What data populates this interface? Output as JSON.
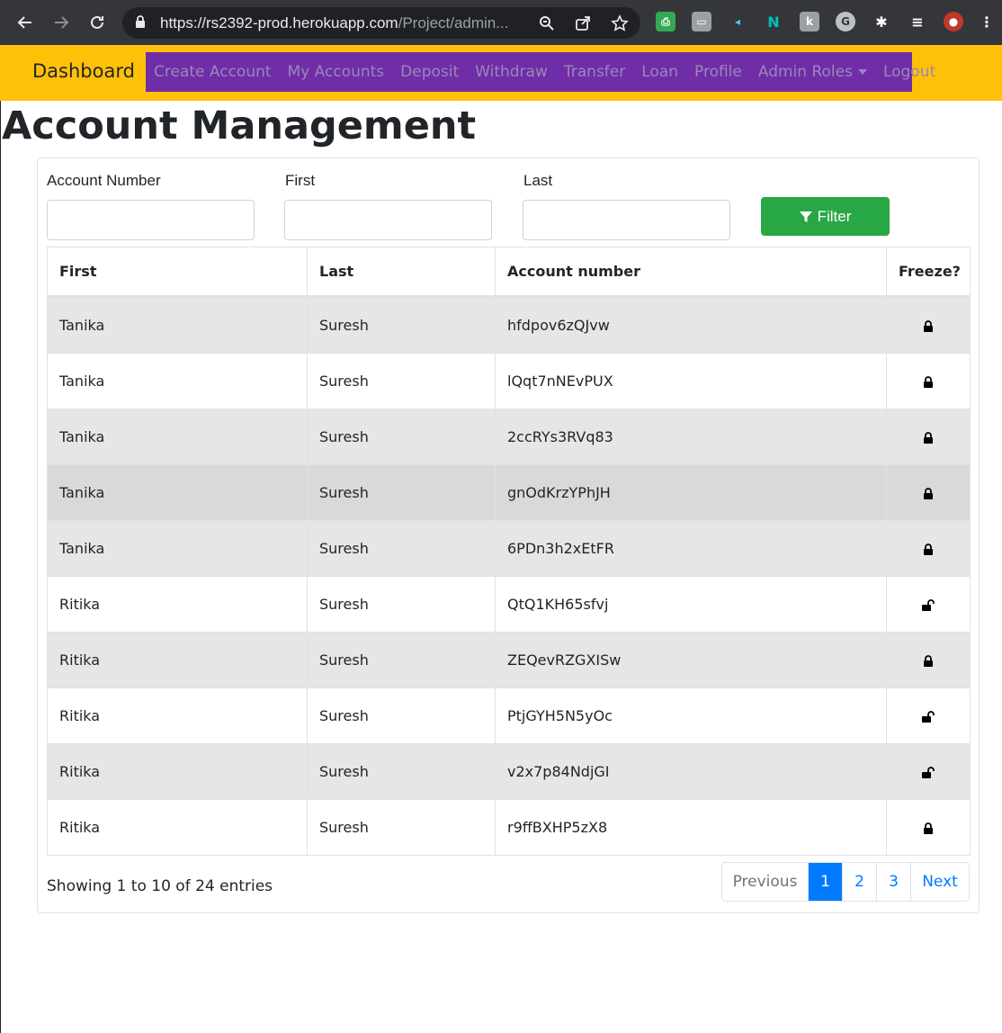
{
  "browser": {
    "url_host": "https://rs2392-prod.herokuapp.com",
    "url_path": "/Project/admin..."
  },
  "navbar": {
    "brand": "Dashboard",
    "links": [
      "Create Account",
      "My Accounts",
      "Deposit",
      "Withdraw",
      "Transfer",
      "Loan",
      "Profile",
      "Admin Roles",
      "Logout"
    ],
    "brand_color": "#ffc107",
    "links_bg": "#6f2da8"
  },
  "page": {
    "title": "Account Management"
  },
  "filters": {
    "account_number_label": "Account Number",
    "first_label": "First",
    "last_label": "Last",
    "filter_button": "Filter"
  },
  "table": {
    "headers": [
      "First",
      "Last",
      "Account number",
      "Freeze?"
    ],
    "rows": [
      {
        "first": "Tanika",
        "last": "Suresh",
        "account": "hfdpov6zQJvw",
        "frozen": true
      },
      {
        "first": "Tanika",
        "last": "Suresh",
        "account": "lQqt7nNEvPUX",
        "frozen": true
      },
      {
        "first": "Tanika",
        "last": "Suresh",
        "account": "2ccRYs3RVq83",
        "frozen": true
      },
      {
        "first": "Tanika",
        "last": "Suresh",
        "account": "gnOdKrzYPhJH",
        "frozen": true
      },
      {
        "first": "Tanika",
        "last": "Suresh",
        "account": "6PDn3h2xEtFR",
        "frozen": true
      },
      {
        "first": "Ritika",
        "last": "Suresh",
        "account": "QtQ1KH65sfvj",
        "frozen": false
      },
      {
        "first": "Ritika",
        "last": "Suresh",
        "account": "ZEQevRZGXISw",
        "frozen": true
      },
      {
        "first": "Ritika",
        "last": "Suresh",
        "account": "PtjGYH5N5yOc",
        "frozen": false
      },
      {
        "first": "Ritika",
        "last": "Suresh",
        "account": "v2x7p84NdjGI",
        "frozen": false
      },
      {
        "first": "Ritika",
        "last": "Suresh",
        "account": "r9ffBXHP5zX8",
        "frozen": true
      }
    ]
  },
  "footer": {
    "showing": "Showing 1 to 10 of 24 entries",
    "pagination": {
      "previous": "Previous",
      "pages": [
        "1",
        "2",
        "3"
      ],
      "active": "1",
      "next": "Next"
    }
  },
  "colors": {
    "filter_button": "#28a745",
    "active_page": "#007bff"
  }
}
